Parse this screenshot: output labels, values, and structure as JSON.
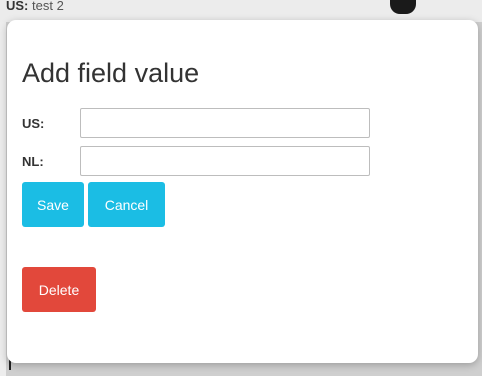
{
  "background": {
    "label": "US:",
    "value": "test 2"
  },
  "modal": {
    "title": "Add field value",
    "fields": [
      {
        "label": "US:",
        "value": "",
        "placeholder": ""
      },
      {
        "label": "NL:",
        "value": "",
        "placeholder": ""
      }
    ],
    "buttons": {
      "save": "Save",
      "cancel": "Cancel",
      "delete": "Delete"
    }
  },
  "colors": {
    "info": "#1bbde4",
    "danger": "#e2483b"
  }
}
